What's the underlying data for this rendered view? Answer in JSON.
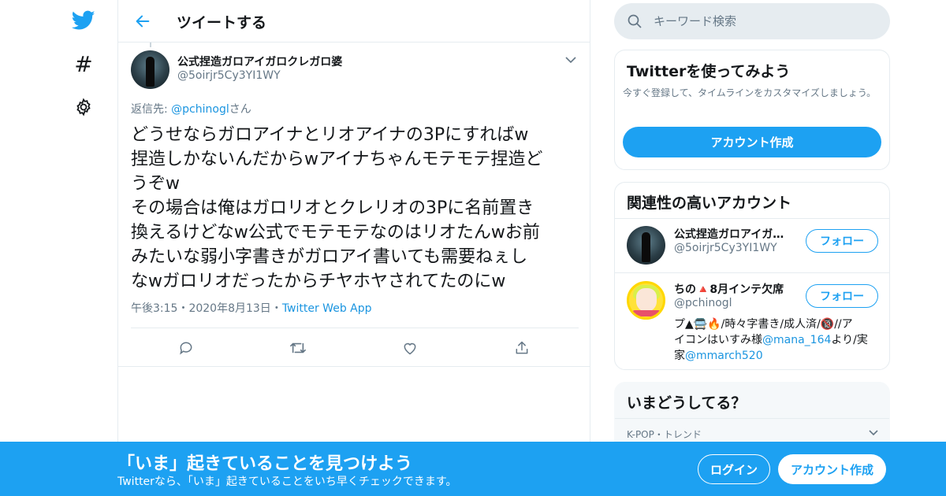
{
  "colors": {
    "accent": "#1da1f2",
    "link": "#1b95e0",
    "muted": "#657786",
    "border": "#e6ecf0"
  },
  "nav": {
    "items": [
      "twitter-logo-icon",
      "hashtag-icon",
      "gear-icon"
    ],
    "hash_glyph": "#"
  },
  "header": {
    "title": "ツイートする"
  },
  "tweet": {
    "display_name": "公式捏造ガロアイガロクレガロ婆",
    "handle": "@5oirjr5Cy3YI1WY",
    "reply_prefix": "返信先: ",
    "reply_mention": "@pchinogl",
    "reply_suffix": "さん",
    "text": "どうせならガロアイナとリオアイナの3Pにすればw\n捏造しかないんだからwアイナちゃんモテモテ捏造ど\nうぞw\nその場合は俺はガロリオとクレリオの3Pに名前置き\n換えるけどなw公式でモテモテなのはリオたんwお前\nみたいな弱小字書きがガロアイ書いても需要ねぇし\nなwガロリオだったからチヤホヤされてたのにw",
    "time": "午後3:15",
    "date": "2020年8月13日",
    "separator": "・",
    "app": "Twitter Web App"
  },
  "search": {
    "placeholder": "キーワード検索"
  },
  "signup_card": {
    "title": "Twitterを使ってみよう",
    "description": "今すぐ登録して、タイムラインをカスタマイズしましょう。",
    "button": "アカウント作成"
  },
  "related": {
    "title": "関連性の高いアカウント",
    "accounts": [
      {
        "name": "公式捏造ガロアイガ…",
        "handle": "@5oirjr5Cy3YI1WY",
        "follow": "フォロー"
      },
      {
        "name": "ちの🔺8月インテ欠席",
        "handle": "@pchinogl",
        "follow": "フォロー"
      }
    ],
    "bio_1": "プ▲🚍🔥/時々字書き/成人済/🔞//ア\nイコンはいすみ様",
    "bio_mention_1": "@mana_164",
    "bio_2": "より/実\n家",
    "bio_mention_2": "@mmarch520"
  },
  "trends": {
    "title": "いまどうしてる？",
    "category": "K-POP・トレンド"
  },
  "banner": {
    "title": "「いま」起きていることを見つけよう",
    "subtitle": "Twitterなら、「いま」起きていることをいち早くチェックできます。",
    "login": "ログイン",
    "signup": "アカウント作成"
  }
}
